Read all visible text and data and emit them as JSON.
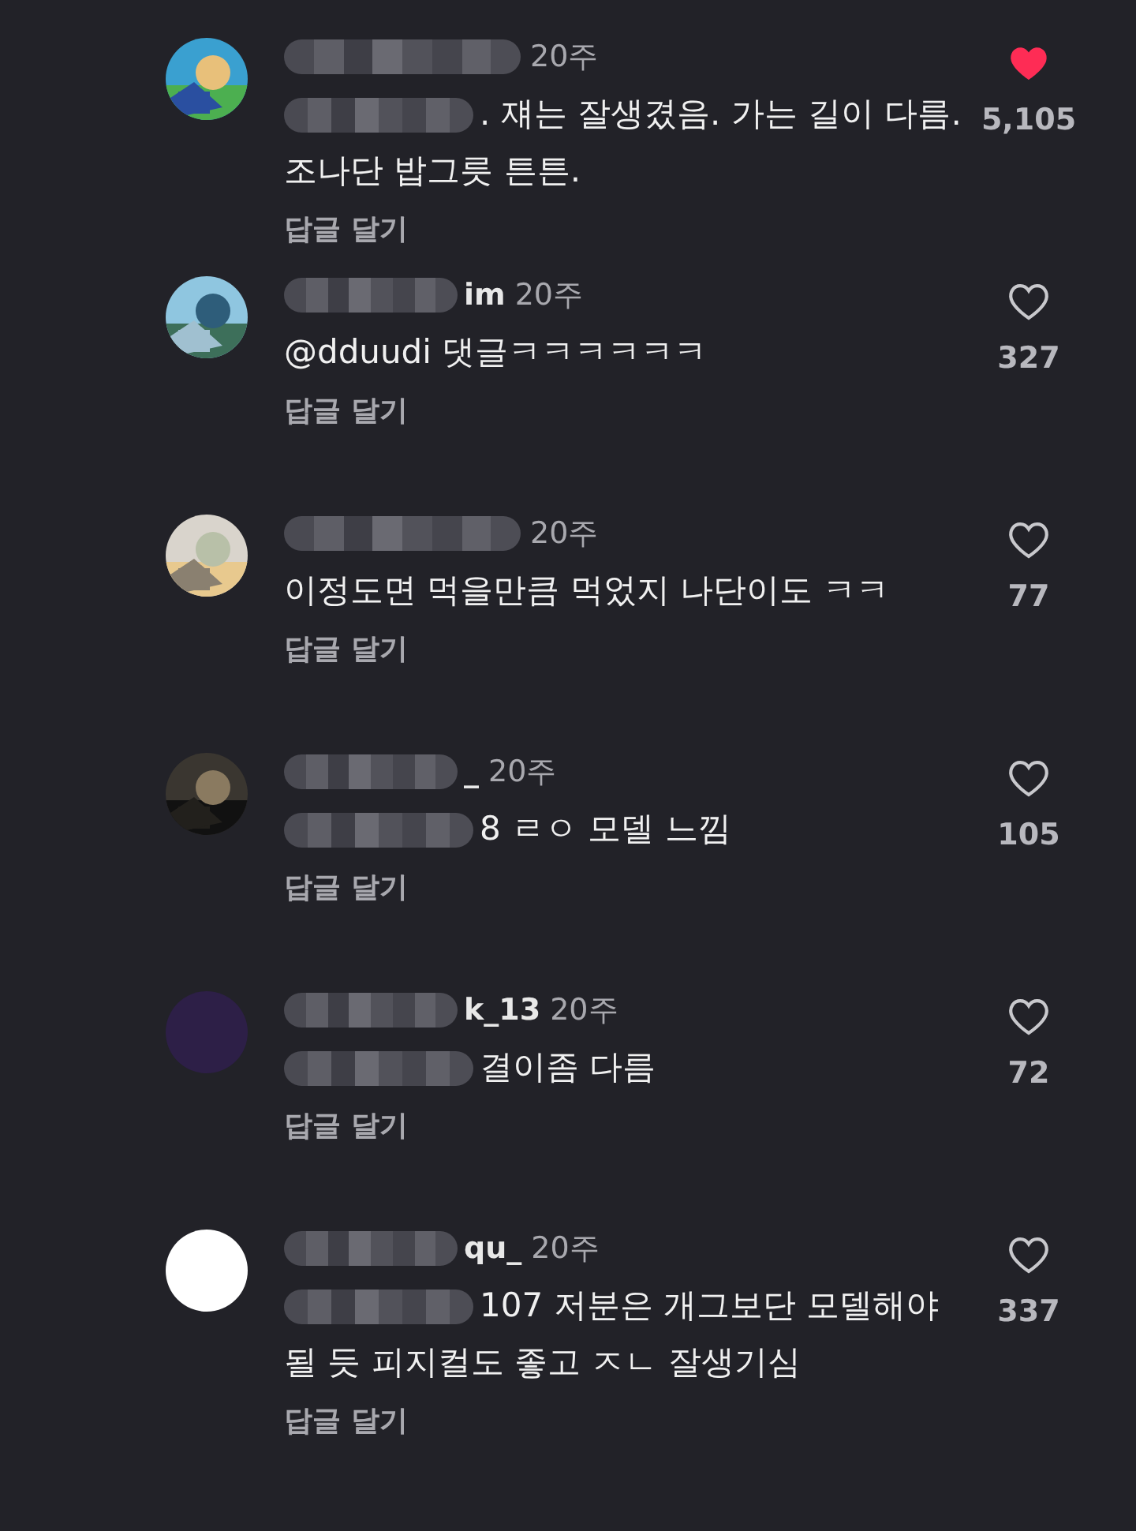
{
  "comments": [
    {
      "username_redacted": true,
      "time": "20주",
      "body_redacted": true,
      "body": ". 쟤는 잘생겼음. 가는 길이 다름. 조나단 밥그릇 튼튼.",
      "reply": "답글 달기",
      "liked": true,
      "likes": "5,105"
    },
    {
      "username": "im",
      "username_redacted": true,
      "time": "20주",
      "body_redacted": false,
      "body": "@dduudi 댓글ㅋㅋㅋㅋㅋㅋ",
      "reply": "답글 달기",
      "liked": false,
      "likes": "327"
    },
    {
      "username_redacted": true,
      "time": "20주",
      "body_redacted": false,
      "body": "이정도면 먹을만큼 먹었지 나단이도 ㅋㅋ",
      "reply": "답글 달기",
      "liked": false,
      "likes": "77"
    },
    {
      "username": "_",
      "username_redacted": true,
      "time": "20주",
      "body_redacted": true,
      "body": "8 ㄹㅇ 모델 느낌",
      "reply": "답글 달기",
      "liked": false,
      "likes": "105"
    },
    {
      "avatar": {
        "kind": "plain",
        "color": "#2d1f47"
      },
      "username": "k_13",
      "username_redacted": true,
      "time": "20주",
      "body_redacted": true,
      "body": "결이좀 다름",
      "reply": "답글 달기",
      "liked": false,
      "likes": "72"
    },
    {
      "avatar": {
        "kind": "plain",
        "color": "#ffffff"
      },
      "username": "qu_",
      "username_redacted": true,
      "time": "20주",
      "body_redacted": true,
      "body": "107 저분은 개그보단 모델해야될 듯 피지컬도 좋고 ㅈㄴ 잘생기심",
      "reply": "답글 달기",
      "liked": false,
      "likes": "337"
    }
  ]
}
